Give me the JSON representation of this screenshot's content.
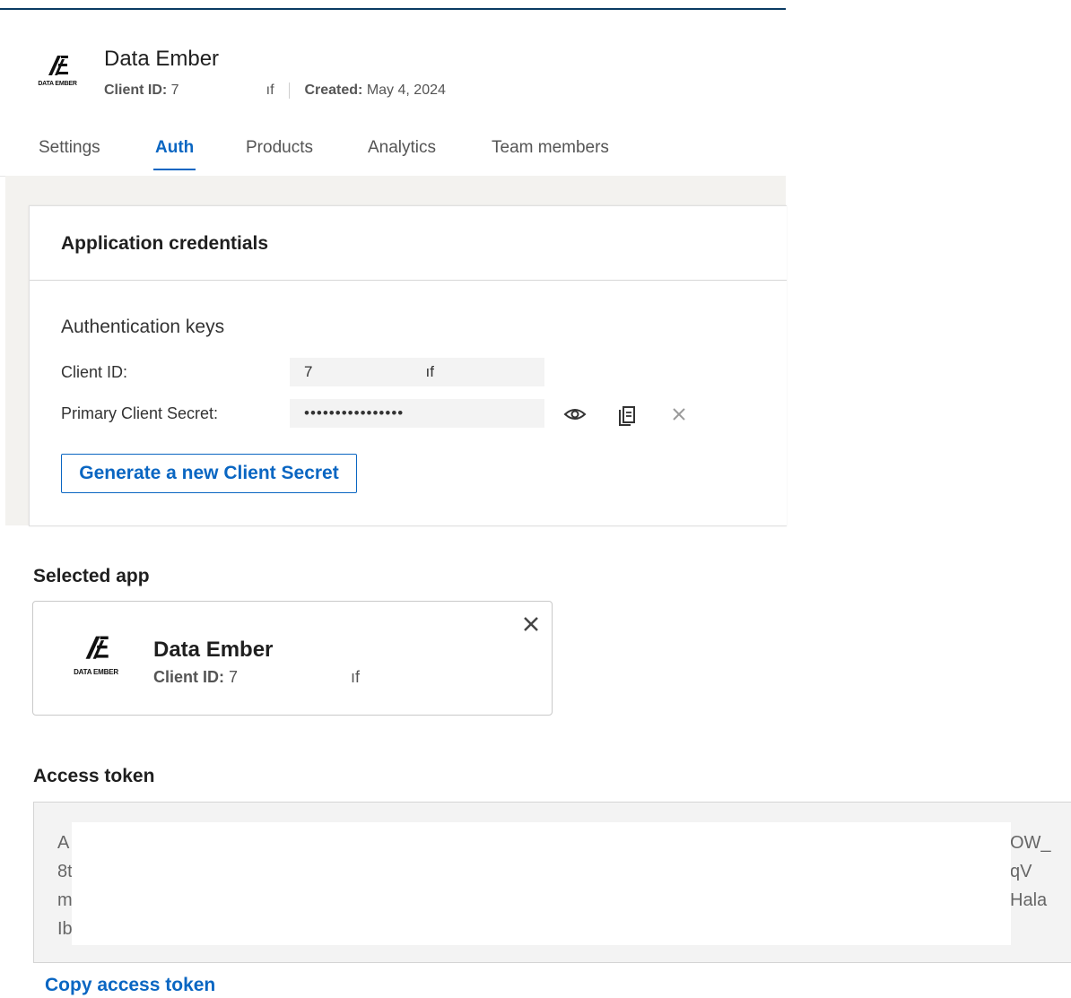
{
  "app": {
    "name": "Data Ember",
    "logo_text": "DATA EMBER",
    "client_id_label": "Client ID:",
    "client_id_start": "7",
    "client_id_end": "ıf",
    "created_label": "Created:",
    "created_value": "May 4, 2024"
  },
  "tabs": [
    {
      "label": "Settings",
      "active": false
    },
    {
      "label": "Auth",
      "active": true
    },
    {
      "label": "Products",
      "active": false
    },
    {
      "label": "Analytics",
      "active": false
    },
    {
      "label": "Team members",
      "active": false
    }
  ],
  "credentials": {
    "title": "Application credentials",
    "subtitle": "Authentication keys",
    "client_id_label": "Client ID:",
    "client_id_start": "7",
    "client_id_end": "ıf",
    "secret_label": "Primary Client Secret:",
    "secret_masked": "••••••••••••••••",
    "icons": [
      "eye-icon",
      "copy-icon",
      "close-icon"
    ],
    "generate_button": "Generate a new Client Secret"
  },
  "selected_app": {
    "heading": "Selected app",
    "name": "Data Ember",
    "logo_text": "DATA EMBER",
    "client_id_label": "Client ID:",
    "client_id_start": "7",
    "client_id_end": "ıf"
  },
  "access_token": {
    "heading": "Access token",
    "line_starts": [
      "A",
      "8t",
      "m",
      "Ib"
    ],
    "line_ends": [
      "OW_",
      "qV",
      "Hala",
      ""
    ],
    "copy_link": "Copy access token"
  },
  "colors": {
    "accent": "#0a66c2",
    "top_rule": "#0a3b63",
    "panel_bg": "#f3f2ef"
  }
}
